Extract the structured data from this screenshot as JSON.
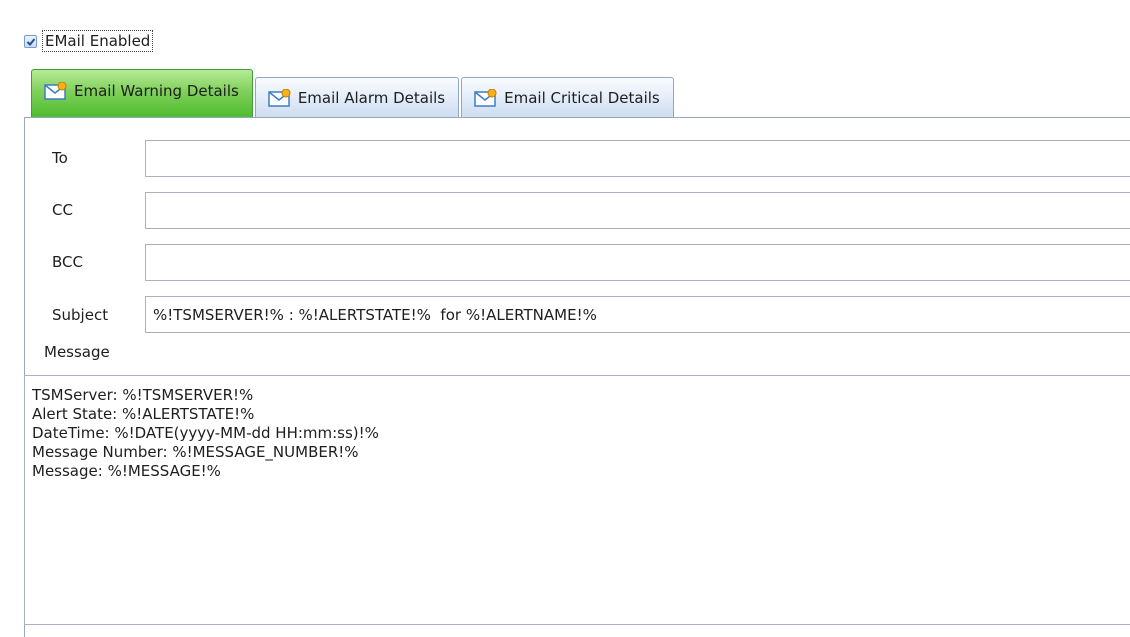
{
  "email_enabled": {
    "label": "EMail Enabled",
    "checked": true
  },
  "tabs": [
    {
      "label": "Email Warning Details",
      "active": true
    },
    {
      "label": "Email Alarm Details",
      "active": false
    },
    {
      "label": "Email Critical Details",
      "active": false
    }
  ],
  "fields": {
    "to": {
      "label": "To",
      "value": ""
    },
    "cc": {
      "label": "CC",
      "value": ""
    },
    "bcc": {
      "label": "BCC",
      "value": ""
    },
    "subject": {
      "label": "Subject",
      "value": "%!TSMSERVER!% : %!ALERTSTATE!%  for %!ALERTNAME!%"
    }
  },
  "message": {
    "label": "Message",
    "value": "TSMServer: %!TSMSERVER!%\nAlert State: %!ALERTSTATE!%\nDateTime: %!DATE(yyyy-MM-dd HH:mm:ss)!%\nMessage Number: %!MESSAGE_NUMBER!%\nMessage: %!MESSAGE!%"
  },
  "colors": {
    "active_tab": "#4dbb2c",
    "inactive_tab": "#cddcf1",
    "border": "#a7b3c4"
  },
  "icons": {
    "tab_icon": "mail-envelope-icon",
    "check": "checkmark-icon"
  }
}
